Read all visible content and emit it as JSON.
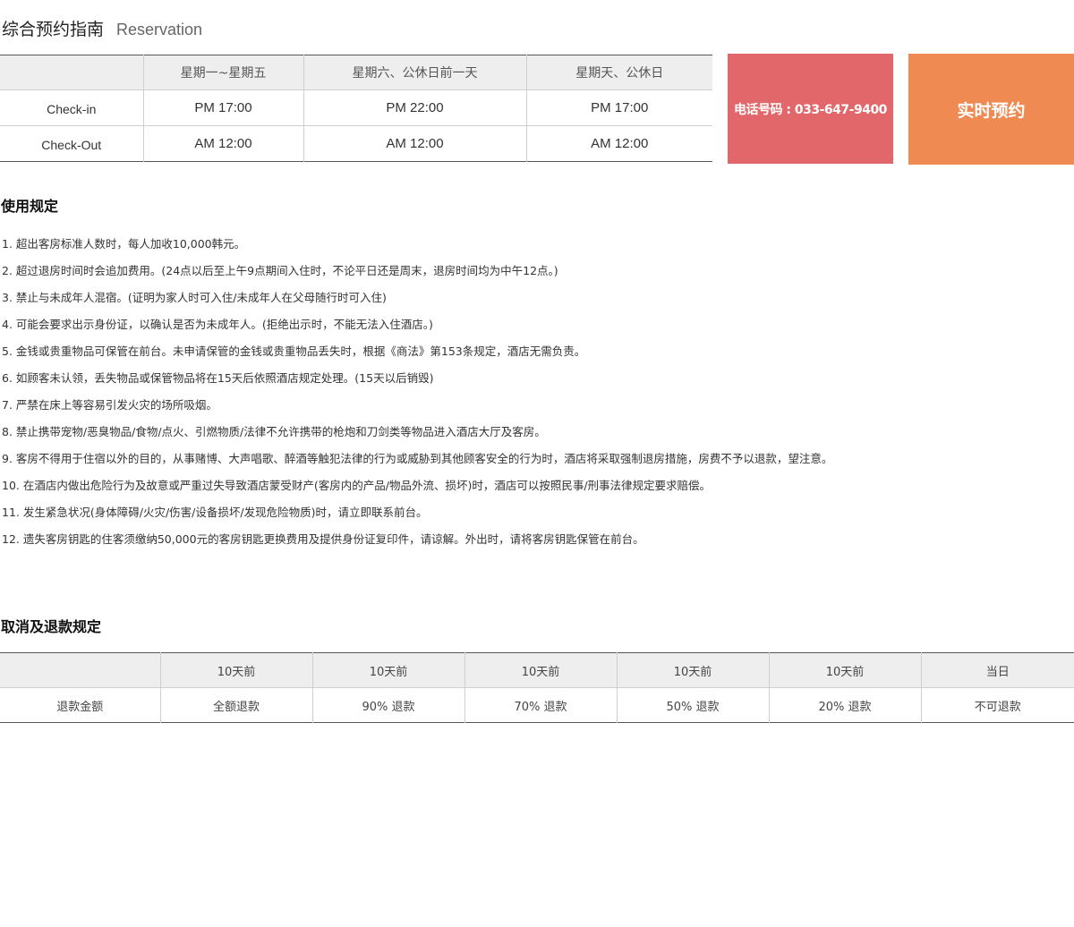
{
  "header": {
    "title": "综合预约指南",
    "subtitle": "Reservation"
  },
  "schedule": {
    "columns": [
      "",
      "星期一~星期五",
      "星期六、公休日前一天",
      "星期天、公休日"
    ],
    "rows": [
      {
        "label": "Check-in",
        "values": [
          "PM 17:00",
          "PM 22:00",
          "PM 17:00"
        ]
      },
      {
        "label": "Check-Out",
        "values": [
          "AM 12:00",
          "AM 12:00",
          "AM 12:00"
        ]
      }
    ]
  },
  "buttons": {
    "phone_label": "电话号码 : 033-647-9400",
    "reserve_label": "实时预约"
  },
  "rules": {
    "title": "使用规定",
    "items": [
      "1. 超出客房标准人数时，每人加收10,000韩元。",
      "2. 超过退房时间时会追加费用。(24点以后至上午9点期间入住时，不论平日还是周末，退房时间均为中午12点。)",
      "3. 禁止与未成年人混宿。(证明为家人时可入住/未成年人在父母随行时可入住)",
      "4. 可能会要求出示身份证，以确认是否为未成年人。(拒绝出示时，不能无法入住酒店。)",
      "5. 金钱或贵重物品可保管在前台。未申请保管的金钱或贵重物品丢失时，根据《商法》第153条规定，酒店无需负责。",
      "6. 如顾客未认领，丢失物品或保管物品将在15天后依照酒店规定处理。(15天以后销毁)",
      "7. 严禁在床上等容易引发火灾的场所吸烟。",
      "8. 禁止携带宠物/恶臭物品/食物/点火、引燃物质/法律不允许携带的枪炮和刀剑类等物品进入酒店大厅及客房。",
      "9. 客房不得用于住宿以外的目的，从事赌博、大声唱歌、醉酒等触犯法律的行为或威胁到其他顾客安全的行为时，酒店将采取强制退房措施，房费不予以退款，望注意。",
      "10. 在酒店内做出危险行为及故意或严重过失导致酒店蒙受财产(客房内的产品/物品外流、损坏)时，酒店可以按照民事/刑事法律规定要求赔偿。",
      "11. 发生紧急状况(身体障碍/火灾/伤害/设备损坏/发现危险物质)时，请立即联系前台。",
      "12. 遗失客房钥匙的住客须缴纳50,000元的客房钥匙更换费用及提供身份证复印件，请谅解。外出时，请将客房钥匙保管在前台。"
    ]
  },
  "refund": {
    "title": "取消及退款规定",
    "columns": [
      "",
      "10天前",
      "10天前",
      "10天前",
      "10天前",
      "10天前",
      "当日"
    ],
    "row_label": "退款金额",
    "values": [
      "全额退款",
      "90% 退款",
      "70% 退款",
      "50% 退款",
      "20% 退款",
      "不可退款"
    ]
  },
  "colors": {
    "phone_button": "#e2676a",
    "reserve_button": "#f08a53",
    "table_header_bg": "#eeeeee"
  }
}
